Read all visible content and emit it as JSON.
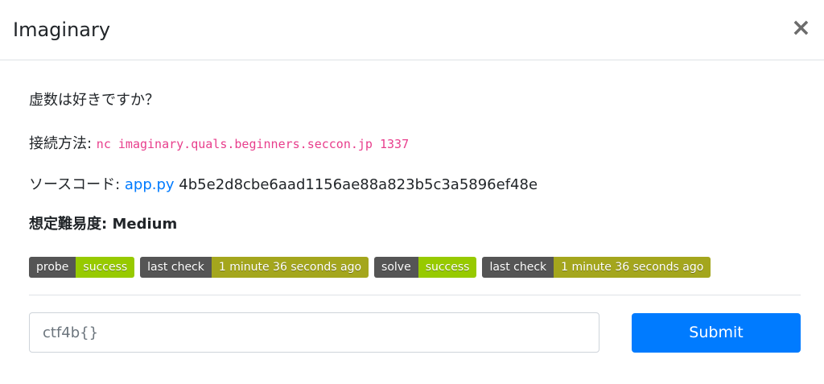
{
  "modal": {
    "title": "Imaginary",
    "close_symbol": "×"
  },
  "body": {
    "description": "虚数は好きですか？",
    "connection_label": "接続方法: ",
    "connection_command": "nc imaginary.quals.beginners.seccon.jp 1337",
    "source_label": "ソースコード: ",
    "source_link": "app.py",
    "source_hash": " 4b5e2d8cbe6aad1156ae88a823b5c3a5896ef48e",
    "difficulty": "想定難易度: Medium"
  },
  "badges": [
    {
      "label": "probe",
      "value": "success",
      "color": "#97ca00"
    },
    {
      "label": "last check",
      "value": "1 minute 36 seconds ago",
      "color": "#a4a61d"
    },
    {
      "label": "solve",
      "value": "success",
      "color": "#97ca00"
    },
    {
      "label": "last check",
      "value": "1 minute 36 seconds ago",
      "color": "#a4a61d"
    }
  ],
  "form": {
    "flag_placeholder": "ctf4b{}",
    "flag_value": "",
    "submit_label": "Submit"
  },
  "colors": {
    "primary": "#007bff",
    "code": "#e83e8c",
    "badge_label_bg": "#555555"
  }
}
